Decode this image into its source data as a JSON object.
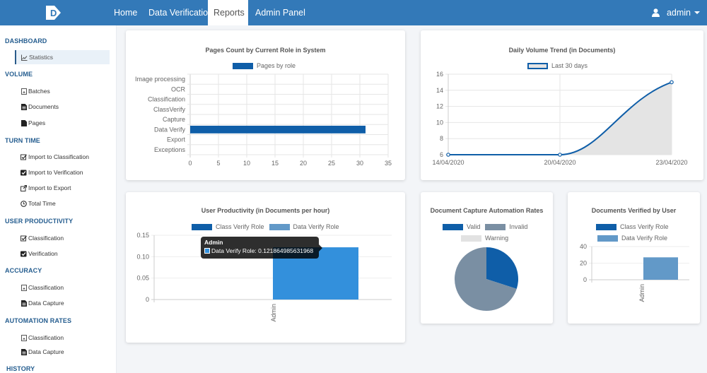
{
  "nav": {
    "logo_letter": "D",
    "items": [
      {
        "label": "Home",
        "active": false
      },
      {
        "label": "Data Verification",
        "active": false
      },
      {
        "label": "Reports",
        "active": true
      },
      {
        "label": "Admin Panel",
        "active": false
      }
    ],
    "user": "admin"
  },
  "sidebar": {
    "sections": [
      {
        "title": "DASHBOARD",
        "items": [
          {
            "label": "Statistics",
            "icon": "line-chart-icon",
            "active": true
          }
        ]
      },
      {
        "title": "VOLUME",
        "items": [
          {
            "label": "Batches",
            "icon": "file-image-icon"
          },
          {
            "label": "Documents",
            "icon": "file-text-icon"
          },
          {
            "label": "Pages",
            "icon": "file-icon"
          }
        ]
      },
      {
        "title": "TURN TIME",
        "items": [
          {
            "label": "Import to Classification",
            "icon": "check-square-outline-icon"
          },
          {
            "label": "Import to Verification",
            "icon": "check-square-icon"
          },
          {
            "label": "Import to Export",
            "icon": "external-link-icon"
          },
          {
            "label": "Total Time",
            "icon": "clock-icon"
          }
        ]
      },
      {
        "title": "USER PRODUCTIVITY",
        "items": [
          {
            "label": "Classification",
            "icon": "check-square-outline-icon"
          },
          {
            "label": "Verification",
            "icon": "check-square-icon"
          }
        ]
      },
      {
        "title": "ACCURACY",
        "items": [
          {
            "label": "Classification",
            "icon": "file-image-icon"
          },
          {
            "label": "Data Capture",
            "icon": "file-text-icon"
          }
        ]
      },
      {
        "title": "AUTOMATION RATES",
        "items": [
          {
            "label": "Classification",
            "icon": "file-image-icon"
          },
          {
            "label": "Data Capture",
            "icon": "file-text-icon"
          }
        ]
      },
      {
        "title": "HISTORY",
        "items": []
      }
    ]
  },
  "colors": {
    "navbar": "#3379b8",
    "primary_bar": "#0f5ea8",
    "data_verify": "#6299c8",
    "data_verify_hover": "#3390dc",
    "invalid": "#7a8fa3",
    "warning": "#e2e2e2",
    "area_fill": "#e4e4e4"
  },
  "chart_data": [
    {
      "id": "pages-by-role",
      "type": "bar",
      "orientation": "horizontal",
      "title": "Pages Count by Current Role in System",
      "categories": [
        "Image processing",
        "OCR",
        "Classification",
        "ClassVerify",
        "Capture",
        "Data Verify",
        "Export",
        "Exceptions"
      ],
      "series": [
        {
          "name": "Pages by role",
          "values": [
            0,
            0,
            0,
            0,
            0,
            31,
            0,
            0
          ]
        }
      ],
      "xlim": [
        0,
        35
      ],
      "xticks": [
        0,
        5,
        10,
        15,
        20,
        25,
        30,
        35
      ],
      "grid": true,
      "legend": "top"
    },
    {
      "id": "daily-volume",
      "type": "line",
      "title": "Daily Volume Trend (in Documents)",
      "x": [
        "14/04/2020",
        "20/04/2020",
        "23/04/2020"
      ],
      "series": [
        {
          "name": "Last 30 days",
          "values": [
            6,
            6,
            15
          ],
          "filled": true
        }
      ],
      "ylim": [
        6,
        16
      ],
      "yticks": [
        6,
        8,
        10,
        12,
        14,
        16
      ],
      "grid": true,
      "legend": "top"
    },
    {
      "id": "user-productivity",
      "type": "bar",
      "title": "User Productivity (in Documents per hour)",
      "categories": [
        "Admin"
      ],
      "series": [
        {
          "name": "Class Verify Role",
          "values": [
            0
          ]
        },
        {
          "name": "Data Verify Role",
          "values": [
            0.121864985631968
          ]
        }
      ],
      "ylim": [
        0,
        0.15
      ],
      "yticks": [
        "0",
        "0.05",
        "0.10",
        "0.15"
      ],
      "grid": true,
      "legend": "top",
      "tooltip": {
        "title": "Admin",
        "label": "Data Verify Role: 0.121864985631968"
      }
    },
    {
      "id": "capture-automation",
      "type": "pie",
      "title": "Document Capture Automation Rates",
      "labels": [
        "Valid",
        "Invalid",
        "Warning"
      ],
      "values": [
        30,
        70,
        0
      ],
      "legend": "top"
    },
    {
      "id": "docs-verified",
      "type": "bar",
      "title": "Documents Verified by User",
      "categories": [
        "Admin"
      ],
      "series": [
        {
          "name": "Class Verify Role",
          "values": [
            0
          ]
        },
        {
          "name": "Data Verify Role",
          "values": [
            27
          ]
        }
      ],
      "ylim": [
        0,
        40
      ],
      "yticks": [
        0,
        20,
        40
      ],
      "grid": true,
      "legend": "top"
    }
  ]
}
